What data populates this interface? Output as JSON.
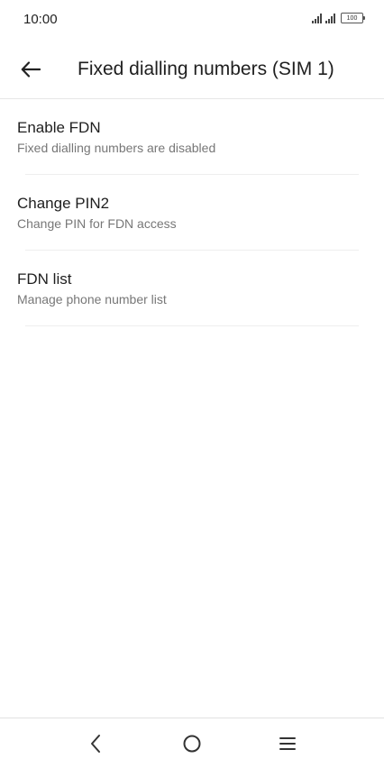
{
  "status_bar": {
    "time": "10:00",
    "battery_level": "100",
    "icons": [
      "signal-icon",
      "signal-icon",
      "battery-icon"
    ]
  },
  "app_bar": {
    "back_icon": "arrow-left-icon",
    "title": "Fixed dialling numbers (SIM 1)"
  },
  "settings": {
    "items": [
      {
        "title": "Enable FDN",
        "subtitle": "Fixed dialling numbers are disabled"
      },
      {
        "title": "Change PIN2",
        "subtitle": "Change PIN for FDN access"
      },
      {
        "title": "FDN list",
        "subtitle": "Manage phone number list"
      }
    ]
  },
  "nav_bar": {
    "icons": [
      "chevron-left-icon",
      "circle-home-icon",
      "menu-lines-icon"
    ]
  },
  "colors": {
    "background": "#ffffff",
    "text_primary": "#1f1f1f",
    "text_secondary": "#777777",
    "divider": "#eeeeee"
  }
}
